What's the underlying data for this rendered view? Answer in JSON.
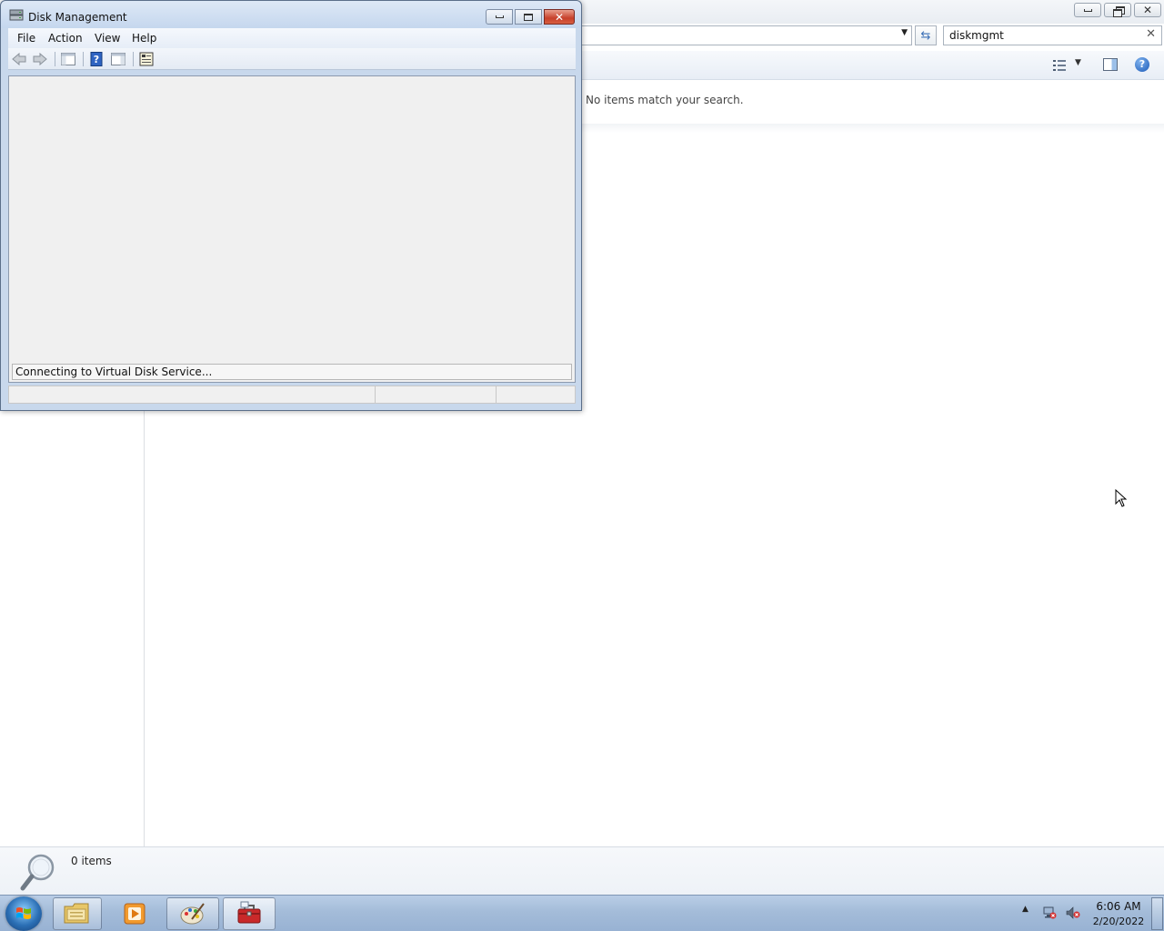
{
  "explorer": {
    "search": {
      "value": "diskmgmt",
      "clear_glyph": "✕"
    },
    "address_dropdown_glyph": "▼",
    "refresh_glyph": "⇆",
    "views_dropdown_glyph": "▼",
    "help_glyph": "?",
    "empty_message": "No items match your search.",
    "details": {
      "count": "0 items"
    },
    "window_controls": {
      "close_glyph": "✕"
    }
  },
  "disk_management": {
    "title": "Disk Management",
    "menu": {
      "file": "File",
      "action": "Action",
      "view": "View",
      "help": "Help"
    },
    "status_message": "Connecting to Virtual Disk Service...",
    "close_glyph": "✕"
  },
  "taskbar": {
    "clock": {
      "time": "6:06 AM",
      "date": "2/20/2022"
    },
    "tray_up_glyph": "▲"
  },
  "colors": {
    "dm_frame": "#c8d8ec",
    "close_red": "#c7402b",
    "taskbar": "#a4bcd9"
  }
}
